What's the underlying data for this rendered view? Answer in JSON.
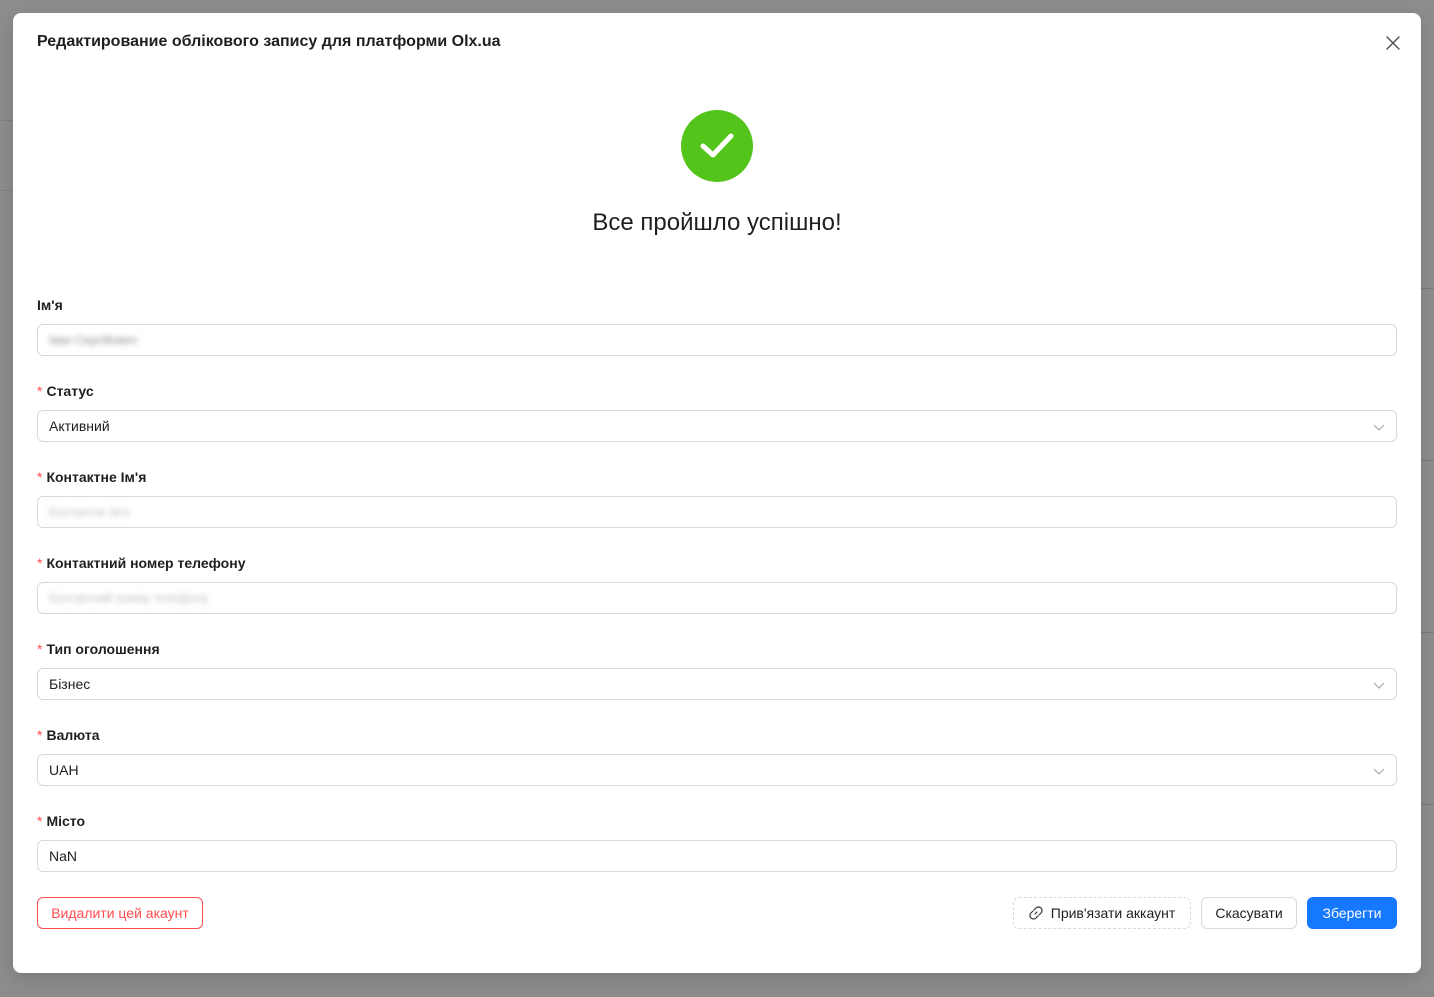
{
  "modal": {
    "title": "Редактирование облікового запису для платформи Olx.ua",
    "success_message": "Все пройшло успішно!"
  },
  "form": {
    "name": {
      "label": "Ім'я",
      "value": "Іван Сергійович"
    },
    "status": {
      "label": "Статус",
      "value": "Активний"
    },
    "contact_name": {
      "label": "Контактне Ім'я",
      "placeholder": "Контактне Ім'я"
    },
    "contact_phone": {
      "label": "Контактний номер телефону",
      "placeholder": "Контактний номер телефону"
    },
    "ad_type": {
      "label": "Тип оголошення",
      "value": "Бізнес"
    },
    "currency": {
      "label": "Валюта",
      "value": "UAH"
    },
    "city": {
      "label": "Місто",
      "value": "NaN"
    }
  },
  "actions": {
    "delete_label": "Видалити цей акаунт",
    "link_label": "Прив'язати аккаунт",
    "cancel_label": "Скасувати",
    "save_label": "Зберегти"
  },
  "colors": {
    "success": "#52c41a",
    "primary": "#1677ff",
    "danger": "#ff4d4f"
  },
  "icons": {
    "close": "close-icon",
    "success": "check-circle-icon",
    "select": "chevron-down-icon",
    "link": "link-icon"
  }
}
